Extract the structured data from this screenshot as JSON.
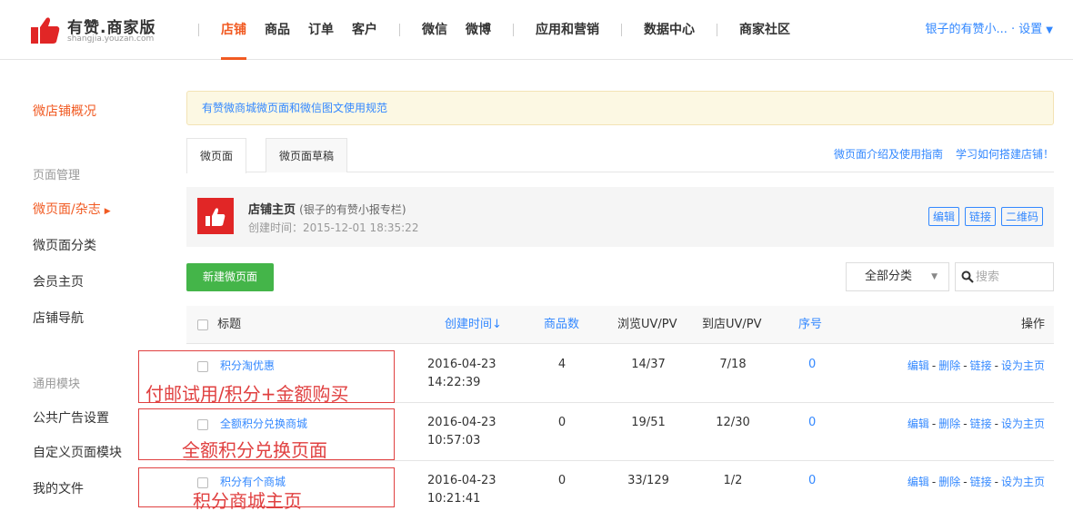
{
  "header": {
    "logo_title": "有赞.商家版",
    "logo_sub": "shangjia.youzan.com",
    "nav_items": [
      "店铺",
      "商品",
      "订单",
      "客户",
      "微信",
      "微博",
      "应用和营销",
      "数据中心",
      "商家社区"
    ],
    "user_label": "银子的有赞小... · 设置",
    "accent_color": "#f15a22"
  },
  "sidebar": {
    "overview": "微店铺概况",
    "group_page": "页面管理",
    "items": [
      "微页面/杂志",
      "微页面分类",
      "会员主页",
      "店铺导航"
    ],
    "group_common": "通用模块",
    "common_items": [
      "公共广告设置",
      "自定义页面模块",
      "我的文件"
    ]
  },
  "notice": "有赞微商城微页面和微信图文使用规范",
  "tabs": [
    "微页面",
    "微页面草稿"
  ],
  "tab_links": [
    "微页面介绍及使用指南",
    "学习如何搭建店铺！"
  ],
  "home_card": {
    "title": "店铺主页",
    "subtitle": "(银子的有赞小报专栏)",
    "created": "创建时间：2015-12-01 18:35:22",
    "actions": [
      "编辑",
      "链接",
      "二维码"
    ]
  },
  "toolbar": {
    "new_button": "新建微页面",
    "filter": "全部分类",
    "search_placeholder": "搜索"
  },
  "table": {
    "headers": {
      "title": "标题",
      "created": "创建时间↓",
      "goods": "商品数",
      "view": "浏览UV/PV",
      "store": "到店UV/PV",
      "order": "序号",
      "ops": "操作"
    },
    "rows": [
      {
        "title": "积分淘优惠",
        "date": "2016-04-23",
        "time": "14:22:39",
        "goods": "4",
        "view": "14/37",
        "store": "7/18",
        "order": "0"
      },
      {
        "title": "全额积分兑换商城",
        "date": "2016-04-23",
        "time": "10:57:03",
        "goods": "0",
        "view": "19/51",
        "store": "12/30",
        "order": "0"
      },
      {
        "title": "积分有个商城",
        "date": "2016-04-23",
        "time": "10:21:41",
        "goods": "0",
        "view": "33/129",
        "store": "1/2",
        "order": "0"
      }
    ],
    "ops": [
      "编辑",
      "删除",
      "链接",
      "设为主页"
    ]
  },
  "annotations": [
    "付邮试用/积分+金额购买",
    "全额积分兑换页面",
    "积分商城主页"
  ]
}
